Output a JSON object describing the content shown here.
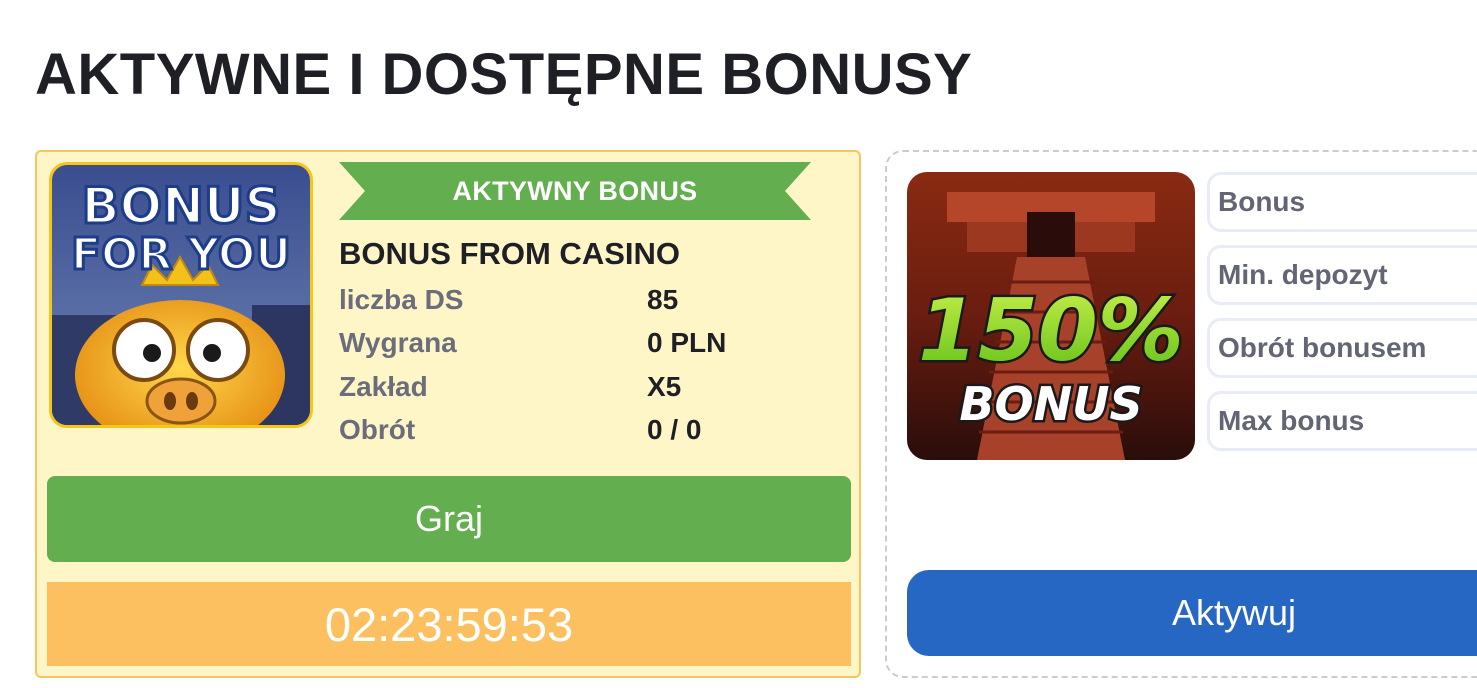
{
  "page": {
    "title": "AKTYWNE I DOSTĘPNE BONUSY"
  },
  "active_bonus": {
    "thumbnail_text": [
      "BONUS",
      "FOR YOU"
    ],
    "ribbon_label": "AKTYWNY BONUS",
    "name": "BONUS FROM CASINO",
    "stats": [
      {
        "label": "liczba DS",
        "value": "85"
      },
      {
        "label": "Wygrana",
        "value": "0 PLN"
      },
      {
        "label": "Zakład",
        "value": "X5"
      },
      {
        "label": "Obrót",
        "value": "0 / 0"
      }
    ],
    "play_label": "Graj",
    "timer": "02:23:59:53"
  },
  "available_bonus": {
    "thumbnail_text": [
      "150%",
      "BONUS"
    ],
    "details": [
      "Bonus",
      "Min. depozyt",
      "Obrót bonusem",
      "Max bonus"
    ],
    "activate_label": "Aktywuj"
  },
  "colors": {
    "ribbon_green": "#63ae4e",
    "play_green": "#63ae4e",
    "timer_orange": "#fdc060",
    "activate_blue": "#2767c4",
    "active_card_bg": "#fff6c8",
    "active_card_border": "#f5c563"
  }
}
